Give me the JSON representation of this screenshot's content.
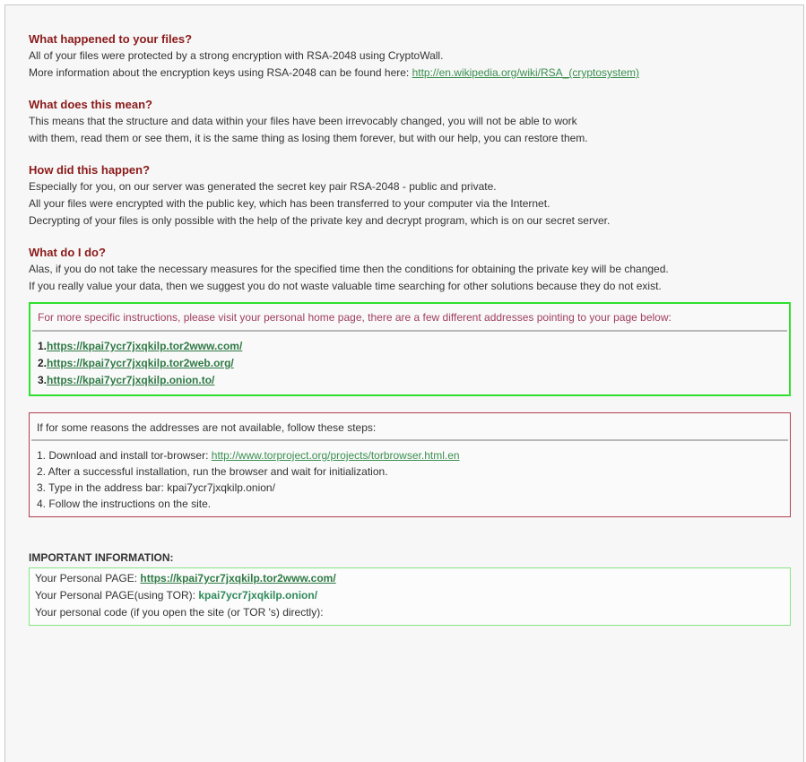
{
  "sections": [
    {
      "heading": "What happened to your files?",
      "lines": [
        "All of your files were protected by a strong encryption with RSA-2048 using CryptoWall.",
        "More information about the encryption keys using RSA-2048 can be found here: "
      ],
      "link": "http://en.wikipedia.org/wiki/RSA_(cryptosystem)"
    },
    {
      "heading": "What does this mean?",
      "lines": [
        "This means that the structure and data within your files have been irrevocably changed, you will not be able to work",
        "with them, read them or see them, it is the same thing as losing them forever, but with our help, you can restore them."
      ]
    },
    {
      "heading": "How did this happen?",
      "lines": [
        "Especially for you, on our server was generated the secret key pair RSA-2048 - public and private.",
        "All your files were encrypted with the public key, which has been transferred to your computer via the Internet.",
        "Decrypting of your files is only possible with the help of the private key and decrypt program, which is on our secret server."
      ]
    },
    {
      "heading": "What do I do?",
      "lines": [
        "Alas, if you do not take the necessary measures for the specified time then the conditions for obtaining the private key will be changed.",
        "If you really value your data, then we suggest you do not waste valuable time searching for other solutions because they do not exist."
      ]
    }
  ],
  "green_box": {
    "intro": "For more specific instructions, please visit your personal home page, there are a few different addresses pointing to your page below:",
    "links": [
      {
        "num": "1.",
        "url": "https://kpai7ycr7jxqkilp.tor2www.com/"
      },
      {
        "num": "2.",
        "url": "https://kpai7ycr7jxqkilp.tor2web.org/"
      },
      {
        "num": "3.",
        "url": "https://kpai7ycr7jxqkilp.onion.to/"
      }
    ]
  },
  "red_box": {
    "intro": "If for some reasons the addresses are not available, follow these steps:",
    "step1_text": "1. Download and install tor-browser: ",
    "step1_link": "http://www.torproject.org/projects/torbrowser.html.en",
    "step2": "2. After a successful installation, run the browser and wait for initialization.",
    "step3": "3. Type in the address bar: kpai7ycr7jxqkilp.onion/",
    "step4": "4. Follow the instructions on the site."
  },
  "important": {
    "title": "IMPORTANT INFORMATION:",
    "page_label": "Your Personal PAGE: ",
    "page_link": "https://kpai7ycr7jxqkilp.tor2www.com/",
    "tor_label": "Your Personal PAGE(using TOR): ",
    "tor_value": "kpai7ycr7jxqkilp.onion/",
    "code_label": "Your personal code (if you open the site (or TOR 's) directly):"
  },
  "colors": {
    "heading": "#8b1a1a",
    "link": "#3a8f4f",
    "green_box_border": "#2fe02f",
    "red_box_border": "#b04050",
    "info_box_border": "#86e586"
  }
}
